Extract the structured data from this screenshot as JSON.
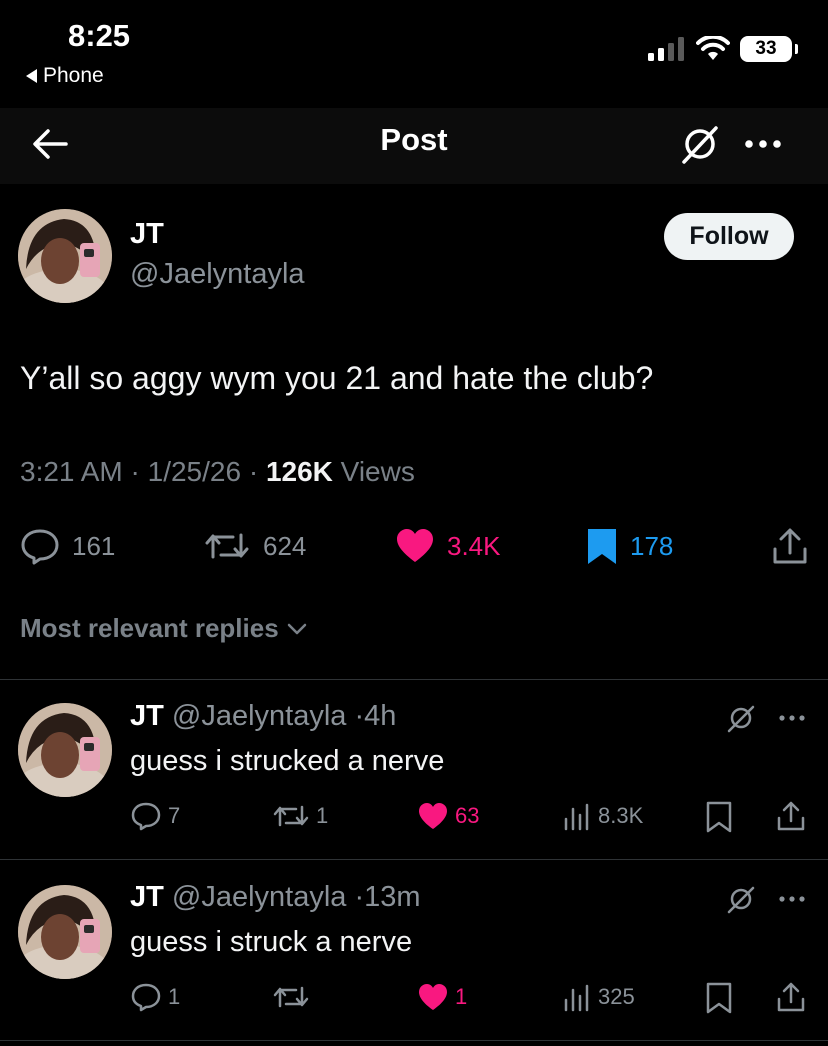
{
  "status_bar": {
    "time": "8:25",
    "back_app": "Phone",
    "battery": "33"
  },
  "nav": {
    "title": "Post"
  },
  "post": {
    "author_name": "JT",
    "author_handle": "@Jaelyntayla",
    "follow_label": "Follow",
    "text": "Y’all so aggy wym you 21 and hate the club?",
    "time": "3:21 AM",
    "date": "1/25/26",
    "views_count": "126K",
    "views_label": "Views",
    "stats": {
      "replies": "161",
      "reposts": "624",
      "likes": "3.4K",
      "bookmarks": "178"
    }
  },
  "sort": {
    "label": "Most relevant replies"
  },
  "replies": [
    {
      "name": "JT",
      "handle": "@Jaelyntayla",
      "age": "4h",
      "text": "guess i strucked a nerve",
      "replies": "7",
      "reposts": "1",
      "likes": "63",
      "views": "8.3K"
    },
    {
      "name": "JT",
      "handle": "@Jaelyntayla",
      "age": "13m",
      "text": "guess i struck a nerve",
      "replies": "1",
      "reposts": "",
      "likes": "1",
      "views": "325"
    }
  ],
  "colors": {
    "like": "#f91880",
    "bookmark": "#1d9bf0",
    "background": "#000000",
    "muted": "#8b9299"
  },
  "icons": [
    "back-arrow-icon",
    "grok-icon",
    "more-icon",
    "reply-icon",
    "repost-icon",
    "heart-icon",
    "bookmark-icon",
    "share-icon",
    "views-icon",
    "chevron-down-icon",
    "signal-icon",
    "wifi-icon",
    "battery-icon"
  ]
}
